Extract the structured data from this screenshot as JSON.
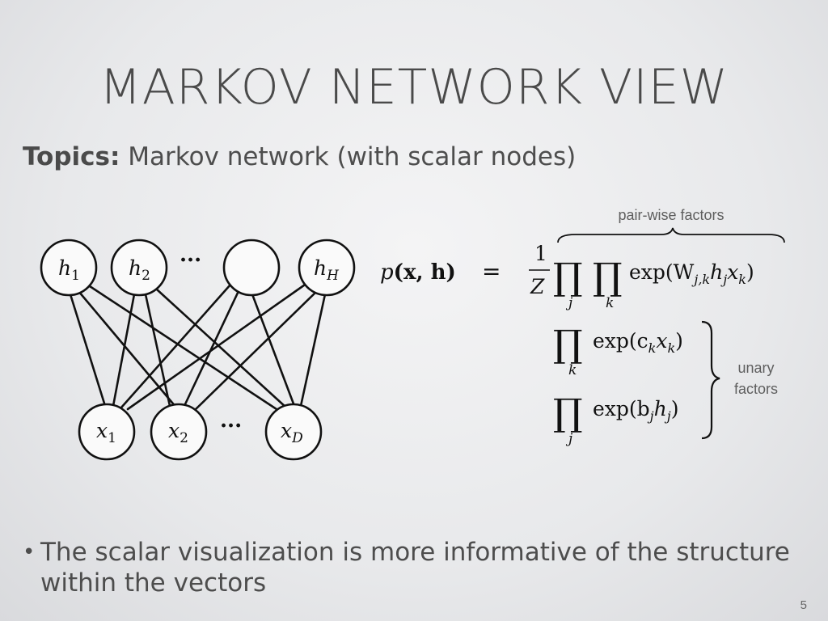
{
  "slide": {
    "title": "MARKOV NETWORK VIEW",
    "topics_label": "Topics:",
    "topics_text": "Markov network (with scalar nodes)",
    "bullet_symbol": "•",
    "bullet_text": "The scalar visualization is more informative of the structure within the vectors",
    "page_number": "5"
  },
  "diagram": {
    "hidden_nodes": [
      {
        "base": "h",
        "sub": "1"
      },
      {
        "base": "h",
        "sub": "2"
      },
      {
        "base": "",
        "sub": ""
      },
      {
        "base": "h",
        "sub": "H"
      }
    ],
    "visible_nodes": [
      {
        "base": "x",
        "sub": "1"
      },
      {
        "base": "x",
        "sub": "2"
      },
      {
        "base": "x",
        "sub": "D"
      }
    ],
    "ellipsis": "···"
  },
  "equation": {
    "lhs_p": "p",
    "lhs_args": "(x, h)",
    "equals": "=",
    "frac_num": "1",
    "frac_den": "Z",
    "prod_symbol": "∏",
    "index_j": "j",
    "index_k": "k",
    "pairwise_term": "exp(W",
    "pairwise_sub": "j,k",
    "pairwise_rest": "h",
    "unary_c_term": "exp(c",
    "unary_b_term": "exp(b",
    "pairwise_label": "pair-wise factors",
    "unary_label_line1": "unary",
    "unary_label_line2": "factors"
  }
}
